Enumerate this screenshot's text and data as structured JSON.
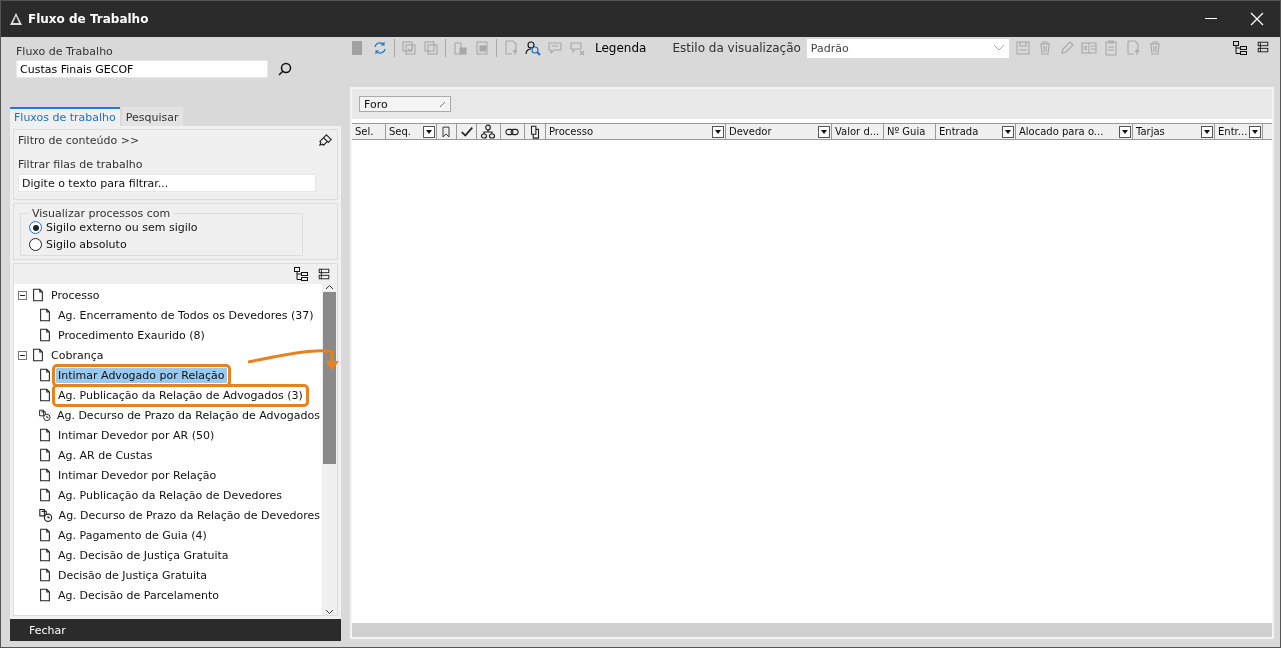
{
  "window": {
    "title": "Fluxo de Trabalho"
  },
  "workflow": {
    "label": "Fluxo de Trabalho",
    "value": "Custas Finais GECOF"
  },
  "tabs": [
    {
      "label": "Fluxos de trabalho",
      "selected": true
    },
    {
      "label": "Pesquisar",
      "selected": false
    }
  ],
  "content_filter": {
    "label": "Filtro de conteúdo >>",
    "filter_label": "Filtrar filas de trabalho",
    "placeholder": "Digite o texto para filtrar..."
  },
  "visibility": {
    "legend": "Visualizar processos com",
    "options": [
      {
        "label": "Sigilo externo ou sem sigilo",
        "selected": true
      },
      {
        "label": "Sigilo absoluto",
        "selected": false
      }
    ]
  },
  "tree": [
    {
      "label": "Processo",
      "kind": "queue",
      "expanded": true,
      "children": [
        {
          "label": "Ag. Encerramento de Todos os Devedores (37)",
          "kind": "queue",
          "selected": false,
          "annotated": false
        },
        {
          "label": "Procedimento Exaurido (8)",
          "kind": "queue",
          "selected": false,
          "annotated": false
        }
      ]
    },
    {
      "label": "Cobrança",
      "kind": "queue",
      "expanded": true,
      "children": [
        {
          "label": "Intimar Advogado por Relação",
          "kind": "queue",
          "selected": true,
          "annotated": true
        },
        {
          "label": "Ag. Publicação da Relação de Advogados (3)",
          "kind": "queue",
          "selected": false,
          "annotated": true
        },
        {
          "label": "Ag. Decurso de Prazo da Relação de Advogados",
          "kind": "timer",
          "selected": false,
          "annotated": false
        },
        {
          "label": "Intimar Devedor por AR (50)",
          "kind": "queue",
          "selected": false,
          "annotated": false
        },
        {
          "label": "Ag. AR de Custas",
          "kind": "queue",
          "selected": false,
          "annotated": false
        },
        {
          "label": "Intimar Devedor por Relação",
          "kind": "queue",
          "selected": false,
          "annotated": false
        },
        {
          "label": "Ag. Publicação da Relação de Devedores",
          "kind": "queue",
          "selected": false,
          "annotated": false
        },
        {
          "label": "Ag. Decurso de Prazo da Relação de Devedores",
          "kind": "timer",
          "selected": false,
          "annotated": false
        },
        {
          "label": "Ag. Pagamento de Guia (4)",
          "kind": "queue",
          "selected": false,
          "annotated": false
        },
        {
          "label": "Ag. Decisão de Justiça Gratuita",
          "kind": "queue",
          "selected": false,
          "annotated": false
        },
        {
          "label": "Decisão de Justiça Gratuita",
          "kind": "queue",
          "selected": false,
          "annotated": false
        },
        {
          "label": "Ag. Decisão de Parcelamento",
          "kind": "queue",
          "selected": false,
          "annotated": false
        }
      ]
    }
  ],
  "close_button": "Fechar",
  "toolbar": {
    "icons": [
      {
        "kind": "doc",
        "disabled": true
      },
      {
        "kind": "refresh",
        "disabled": false
      },
      {
        "kind": "sep"
      },
      {
        "kind": "check",
        "disabled": true
      },
      {
        "kind": "copy",
        "disabled": true
      },
      {
        "kind": "sep"
      },
      {
        "kind": "lock",
        "disabled": true
      },
      {
        "kind": "lock2",
        "disabled": true
      },
      {
        "kind": "sep"
      },
      {
        "kind": "export",
        "disabled": true
      },
      {
        "kind": "user-search",
        "disabled": false
      },
      {
        "kind": "comment",
        "disabled": true
      },
      {
        "kind": "comment-x",
        "disabled": true
      }
    ],
    "legend": "Legenda",
    "view_style_label": "Estilo da visualização",
    "view_style_value": "Padrão",
    "right_icons": [
      {
        "kind": "save",
        "disabled": true
      },
      {
        "kind": "trash",
        "disabled": true
      },
      {
        "kind": "pencil",
        "disabled": true
      },
      {
        "kind": "excel",
        "disabled": true
      },
      {
        "kind": "clipboard",
        "disabled": true
      },
      {
        "kind": "export",
        "disabled": true
      },
      {
        "kind": "trash",
        "disabled": true
      }
    ]
  },
  "group_by": "Foro",
  "columns": [
    {
      "label": "Sel.",
      "kind": "text",
      "filter": false
    },
    {
      "label": "Seq.",
      "kind": "text",
      "filter": true
    },
    {
      "kind": "bookmark",
      "filter": false
    },
    {
      "kind": "check",
      "filter": false
    },
    {
      "kind": "org",
      "filter": false
    },
    {
      "kind": "link",
      "filter": false
    },
    {
      "kind": "doc",
      "filter": false
    },
    {
      "label": "Processo",
      "kind": "text",
      "filter": true
    },
    {
      "label": "Devedor",
      "kind": "text",
      "filter": true
    },
    {
      "label": "Valor d...",
      "kind": "text",
      "filter": false
    },
    {
      "label": "Nº Guia",
      "kind": "text",
      "filter": false
    },
    {
      "label": "Entrada",
      "kind": "text",
      "filter": true
    },
    {
      "label": "Alocado para o...",
      "kind": "text",
      "filter": true
    },
    {
      "label": "Tarjas",
      "kind": "text",
      "filter": true
    },
    {
      "label": "Entr...",
      "kind": "text",
      "filter": true
    }
  ]
}
